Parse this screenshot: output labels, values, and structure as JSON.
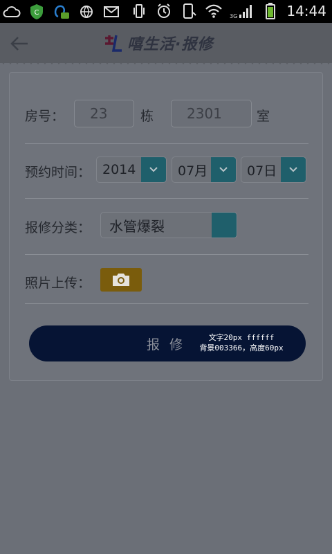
{
  "status_bar": {
    "time": "14:44",
    "network": "3G",
    "left_icons": [
      "cloud-icon",
      "shield-app-icon",
      "chat-app-icon",
      "globe-app-icon",
      "mail-icon"
    ],
    "right_icons": [
      "vibrate-icon",
      "alarm-icon",
      "phone-icon",
      "wifi-icon",
      "signal-icon",
      "battery-icon"
    ]
  },
  "header": {
    "logo_text": "嘻生活·报修"
  },
  "form": {
    "room": {
      "label": "房号：",
      "building_value": "23",
      "building_unit": "栋",
      "room_value": "2301",
      "room_unit": "室"
    },
    "appointment": {
      "label": "预约时间：",
      "year": "2014",
      "month": "07月",
      "day": "07日"
    },
    "category": {
      "label": "报修分类：",
      "value": "水管爆裂"
    },
    "photo": {
      "label": "照片上传："
    },
    "submit": {
      "label": "报修",
      "note_line1": "文字20px ffffff",
      "note_line2": "背景003366，高度60px"
    }
  },
  "colors": {
    "submit_bg": "#003366",
    "accent_teal": "#3fa0ad",
    "camera_orange": "#e8a21a"
  }
}
